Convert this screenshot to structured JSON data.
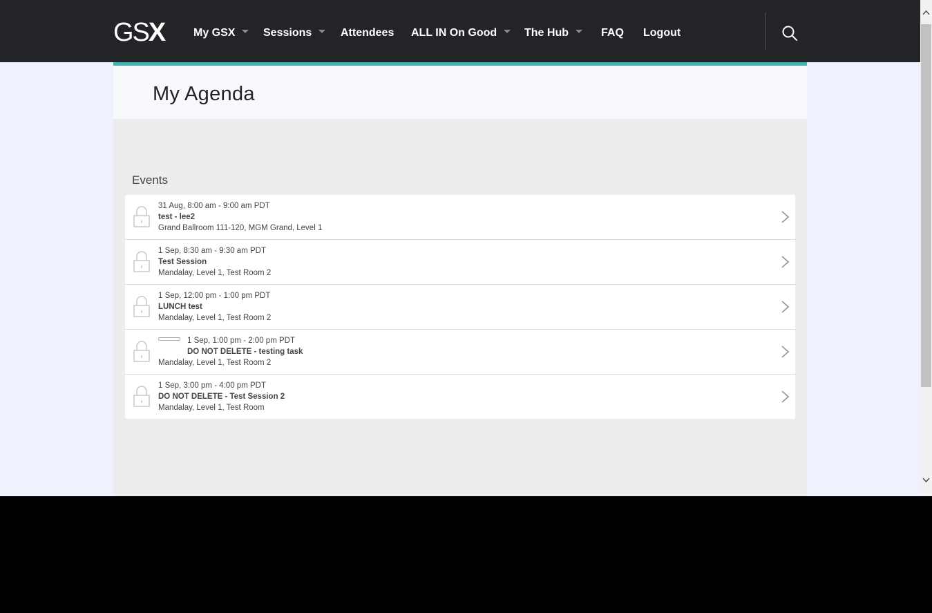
{
  "header": {
    "logo": {
      "gs": "GS",
      "x": "X"
    },
    "nav": [
      {
        "label": "My GSX",
        "has_dropdown": true
      },
      {
        "label": "Sessions",
        "has_dropdown": true
      },
      {
        "label": "Attendees",
        "has_dropdown": false
      },
      {
        "label": "ALL IN On Good",
        "has_dropdown": true
      },
      {
        "label": "The Hub",
        "has_dropdown": true
      },
      {
        "label": "FAQ",
        "has_dropdown": false
      },
      {
        "label": "Logout",
        "has_dropdown": false
      }
    ],
    "search_icon": "search-icon"
  },
  "page": {
    "title": "My Agenda",
    "section_title": "Events"
  },
  "events": [
    {
      "time": "31 Aug, 8:00 am - 9:00 am PDT",
      "name": "test - lee2",
      "location": "Grand Ballroom 111-120, MGM Grand, Level 1",
      "icon": "lock-icon"
    },
    {
      "time": "1 Sep, 8:30 am - 9:30 am PDT",
      "name": "Test Session",
      "location": "Mandalay, Level 1, Test Room 2",
      "icon": "lock-icon"
    },
    {
      "time": "1 Sep, 12:00 pm - 1:00 pm PDT",
      "name": "LUNCH test",
      "location": "Mandalay, Level 1, Test Room 2",
      "icon": "lock-icon"
    },
    {
      "time": "1 Sep, 1:00 pm - 2:00 pm PDT",
      "name": "DO NOT DELETE - testing task",
      "location": "Mandalay, Level 1, Test Room 2",
      "icon": "lock-icon",
      "has_task_box": true
    },
    {
      "time": "1 Sep, 3:00 pm - 4:00 pm PDT",
      "name": "DO NOT DELETE - Test Session 2",
      "location": "Mandalay, Level 1, Test Room",
      "icon": "lock-icon"
    }
  ],
  "colors": {
    "nav_bg": "#232428",
    "accent_teal": "#3ab5b4",
    "page_bg": "#eef2fc",
    "content_bg": "#ededed"
  }
}
